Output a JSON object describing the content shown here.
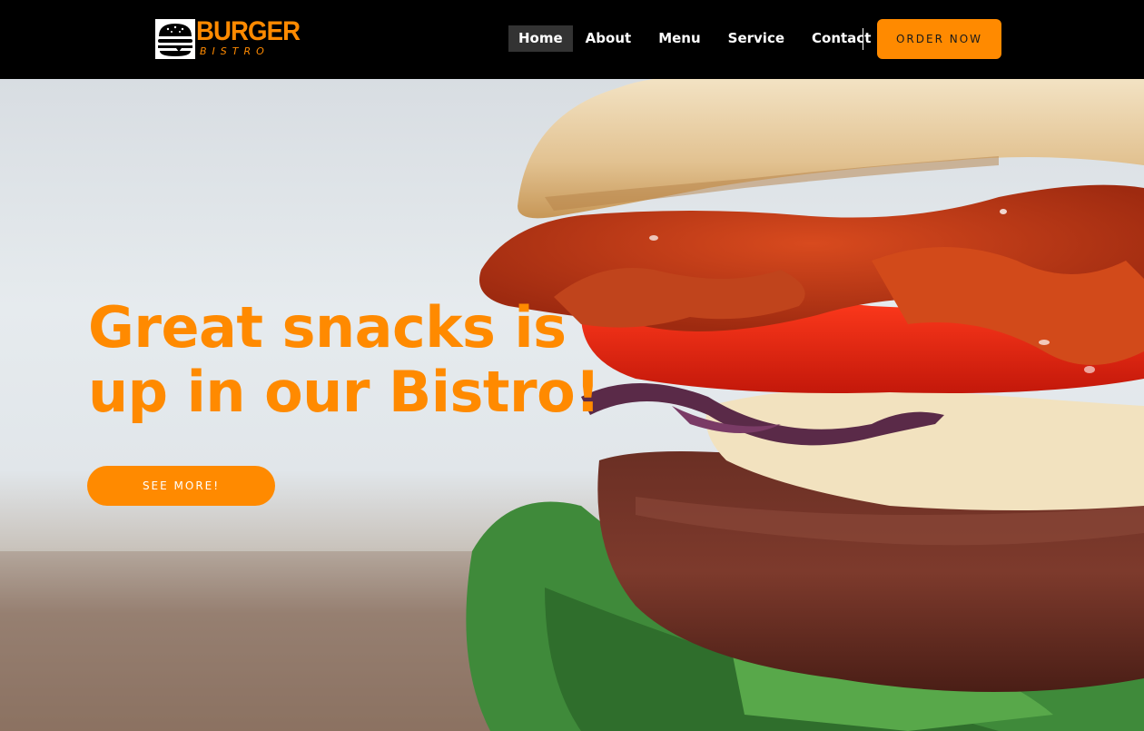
{
  "brand": {
    "name": "BURGER",
    "tagline": "BISTRO",
    "accent_color": "#ff8a00",
    "icon": "burger-logo-icon"
  },
  "nav": {
    "items": [
      {
        "label": "Home",
        "active": true
      },
      {
        "label": "About",
        "active": false
      },
      {
        "label": "Menu",
        "active": false
      },
      {
        "label": "Service",
        "active": false
      },
      {
        "label": "Contact",
        "active": false
      }
    ],
    "cta_label": "ORDER NOW"
  },
  "hero": {
    "headline_line1": "Great snacks is",
    "headline_line2": "up in our Bistro!",
    "button_label": "SEE MORE!",
    "image": "burger-photo"
  },
  "colors": {
    "accent": "#ff8a00",
    "header_bg": "#000000",
    "active_nav_bg": "#333333",
    "text_light": "#ffffff"
  }
}
